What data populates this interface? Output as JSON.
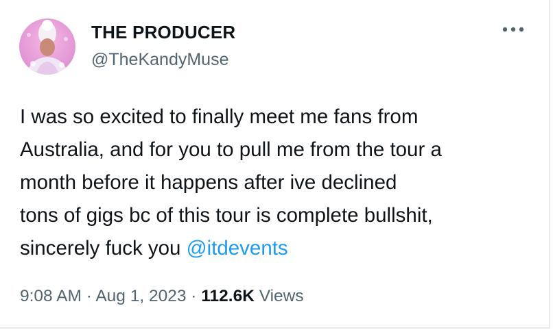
{
  "author": {
    "display_name": "THE PRODUCER",
    "handle": "@TheKandyMuse",
    "avatar_icon": "profile-avatar"
  },
  "menu": {
    "icon": "more-options-icon"
  },
  "tweet": {
    "text": "I was so excited to finally meet me fans from\nAustralia, and for you to pull me from the tour a\nmonth before it happens after ive declined\ntons of gigs bc of this tour is complete bullshit,\nsincerely fuck you ",
    "mention": "@itdevents"
  },
  "meta": {
    "time": "9:08 AM",
    "separator": " · ",
    "date": "Aug 1, 2023",
    "views_count": "112.6K",
    "views_label": " Views"
  },
  "colors": {
    "link": "#1d9bf0",
    "secondary_text": "#536471",
    "primary_text": "#0f1419"
  }
}
